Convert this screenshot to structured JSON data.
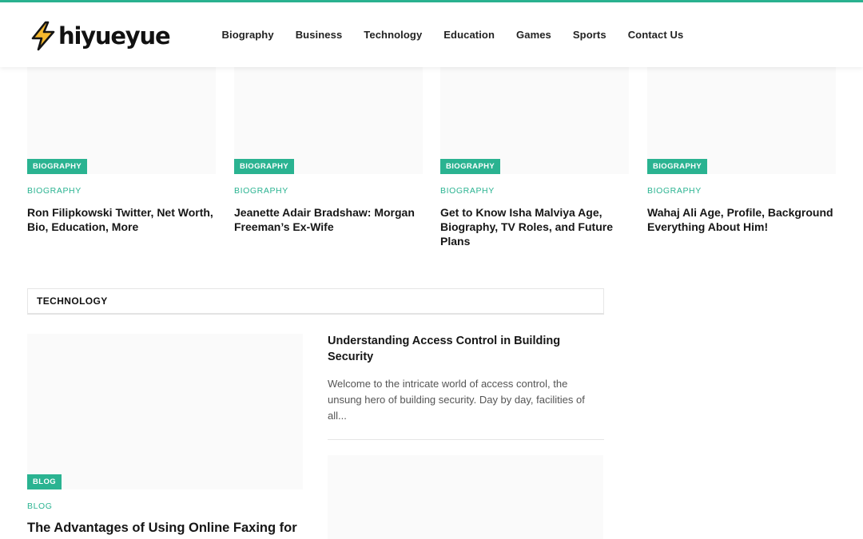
{
  "site": {
    "logo_text": "hiyueyue",
    "accent_color": "#2ab391"
  },
  "nav": {
    "items": [
      {
        "label": "Biography"
      },
      {
        "label": "Business"
      },
      {
        "label": "Technology"
      },
      {
        "label": "Education"
      },
      {
        "label": "Games"
      },
      {
        "label": "Sports"
      },
      {
        "label": "Contact Us"
      }
    ]
  },
  "biography_posts": [
    {
      "badge": "BIOGRAPHY",
      "category": "BIOGRAPHY",
      "title": "Ron Filipkowski Twitter, Net Worth, Bio, Education, More"
    },
    {
      "badge": "BIOGRAPHY",
      "category": "BIOGRAPHY",
      "title": "Jeanette Adair Bradshaw: Morgan Freeman’s Ex-Wife"
    },
    {
      "badge": "BIOGRAPHY",
      "category": "BIOGRAPHY",
      "title": "Get to Know Isha Malviya Age, Biography, TV Roles, and Future Plans"
    },
    {
      "badge": "BIOGRAPHY",
      "category": "BIOGRAPHY",
      "title": "Wahaj Ali Age, Profile, Background Everything About Him!"
    }
  ],
  "technology": {
    "section_title": "TECHNOLOGY",
    "featured": {
      "badge": "BLOG",
      "category": "BLOG",
      "title": "The Advantages of Using Online Faxing for"
    },
    "side_post": {
      "title": "Understanding Access Control in Building Security",
      "excerpt": "Welcome to the intricate world of access control, the unsung hero of building security. Day by day, facilities of all..."
    }
  }
}
